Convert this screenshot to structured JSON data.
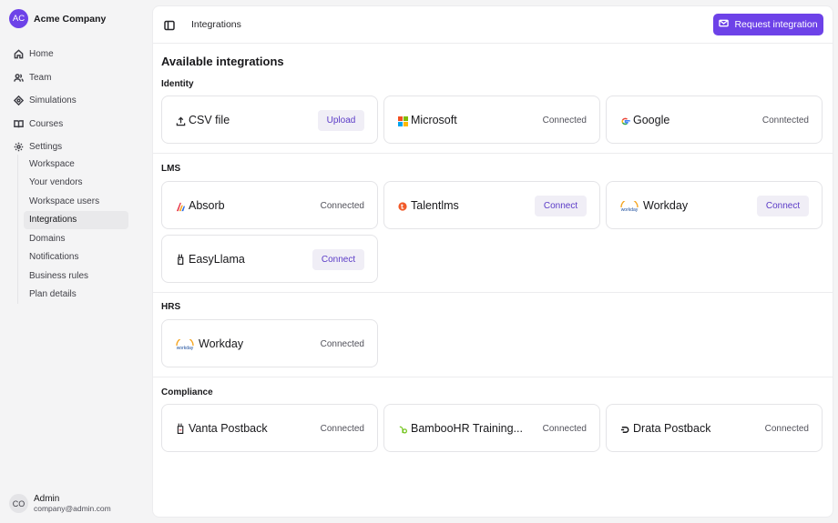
{
  "org": {
    "initials": "AC",
    "name": "Acme Company"
  },
  "nav": [
    {
      "label": "Home",
      "icon": "home-icon"
    },
    {
      "label": "Team",
      "icon": "users-icon"
    },
    {
      "label": "Simulations",
      "icon": "target-icon"
    },
    {
      "label": "Courses",
      "icon": "book-icon"
    },
    {
      "label": "Settings",
      "icon": "gear-icon"
    }
  ],
  "settings_nav": [
    "Workspace",
    "Your vendors",
    "Workspace users",
    "Integrations",
    "Domains",
    "Notifications",
    "Business rules",
    "Plan details"
  ],
  "user": {
    "initials": "CO",
    "name": "Admin",
    "email": "company@admin.com"
  },
  "header": {
    "breadcrumb": "Integrations",
    "request_label": "Request integration"
  },
  "page_title": "Available integrations",
  "sections": {
    "identity": {
      "label": "Identity",
      "cards": [
        {
          "name": "CSV file",
          "action": "Upload",
          "icon": "upload-icon"
        },
        {
          "name": "Microsoft",
          "status": "Connected",
          "icon": "microsoft-logo-icon"
        },
        {
          "name": "Google",
          "status": "Conntected",
          "icon": "google-logo-icon"
        }
      ]
    },
    "lms": {
      "label": "LMS",
      "cards": [
        {
          "name": "Absorb",
          "status": "Connected",
          "icon": "absorb-logo-icon"
        },
        {
          "name": "Talentlms",
          "action": "Connect",
          "icon": "talentlms-logo-icon"
        },
        {
          "name": "Workday",
          "action": "Connect",
          "icon": "workday-logo-icon"
        },
        {
          "name": "EasyLlama",
          "action": "Connect",
          "icon": "easyllama-logo-icon"
        }
      ]
    },
    "hrs": {
      "label": "HRS",
      "cards": [
        {
          "name": "Workday",
          "status": "Connected",
          "icon": "workday-logo-icon"
        }
      ]
    },
    "compliance": {
      "label": "Compliance",
      "cards": [
        {
          "name": "Vanta Postback",
          "status": "Connected",
          "icon": "vanta-logo-icon"
        },
        {
          "name": "BambooHR Training...",
          "status": "Connected",
          "icon": "bamboohr-logo-icon"
        },
        {
          "name": "Drata Postback",
          "status": "Connected",
          "icon": "drata-logo-icon"
        }
      ]
    }
  },
  "colors": {
    "accent": "#6d42e8",
    "button_bg": "#f0eef6",
    "button_text": "#5b3bc7"
  },
  "workday_logo_text": "workday"
}
